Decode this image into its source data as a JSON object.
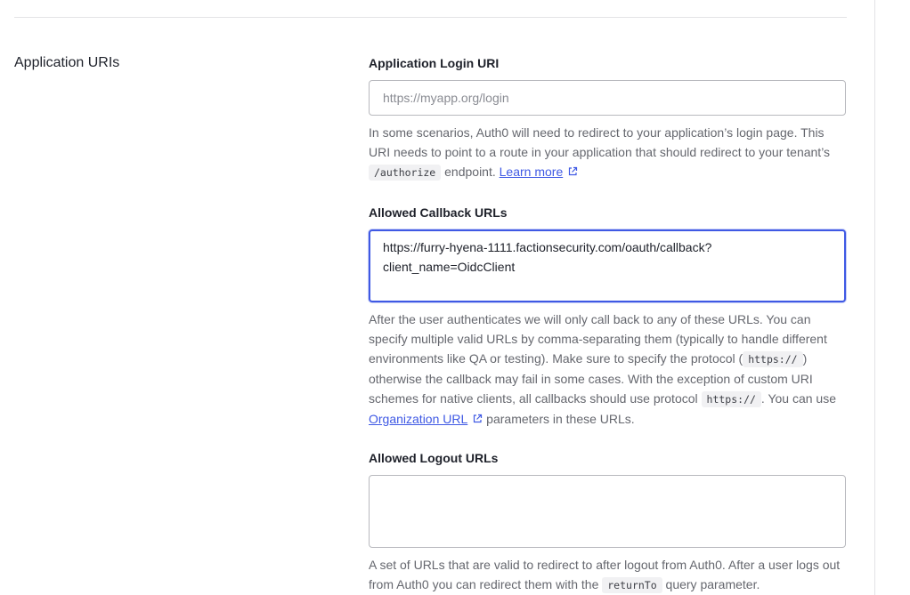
{
  "section": {
    "title": "Application URIs"
  },
  "login_uri": {
    "label": "Application Login URI",
    "placeholder": "https://myapp.org/login",
    "help_part1": "In some scenarios, Auth0 will need to redirect to your application’s login page. This URI needs to point to a route in your application that should redirect to your tenant’s",
    "help_code": "/authorize",
    "help_part2": "endpoint.",
    "help_link": "Learn more"
  },
  "callback_urls": {
    "label": "Allowed Callback URLs",
    "value": "https://furry-hyena-1111.factionsecurity.com/oauth/callback?client_name=OidcClient",
    "help_part1": "After the user authenticates we will only call back to any of these URLs. You can specify multiple valid URLs by comma-separating them (typically to handle different environments like QA or testing). Make sure to specify the protocol (",
    "help_code1": "https://",
    "help_part2": ") otherwise the callback may fail in some cases. With the exception of custom URI schemes for native clients, all callbacks should use protocol",
    "help_code2": "https://",
    "help_part3": ". You can use",
    "help_link": "Organization URL",
    "help_part4": "parameters in these URLs."
  },
  "logout_urls": {
    "label": "Allowed Logout URLs",
    "value": "",
    "help_part1": "A set of URLs that are valid to redirect to after logout from Auth0. After a user logs out from Auth0 you can redirect them with the",
    "help_code": "returnTo",
    "help_part2": "query parameter."
  },
  "colors": {
    "accent": "#3f59e4",
    "text": "#1e212a",
    "muted": "#65676e",
    "border": "#b8b9be"
  },
  "icons": {
    "external_link": "external-link-icon"
  }
}
